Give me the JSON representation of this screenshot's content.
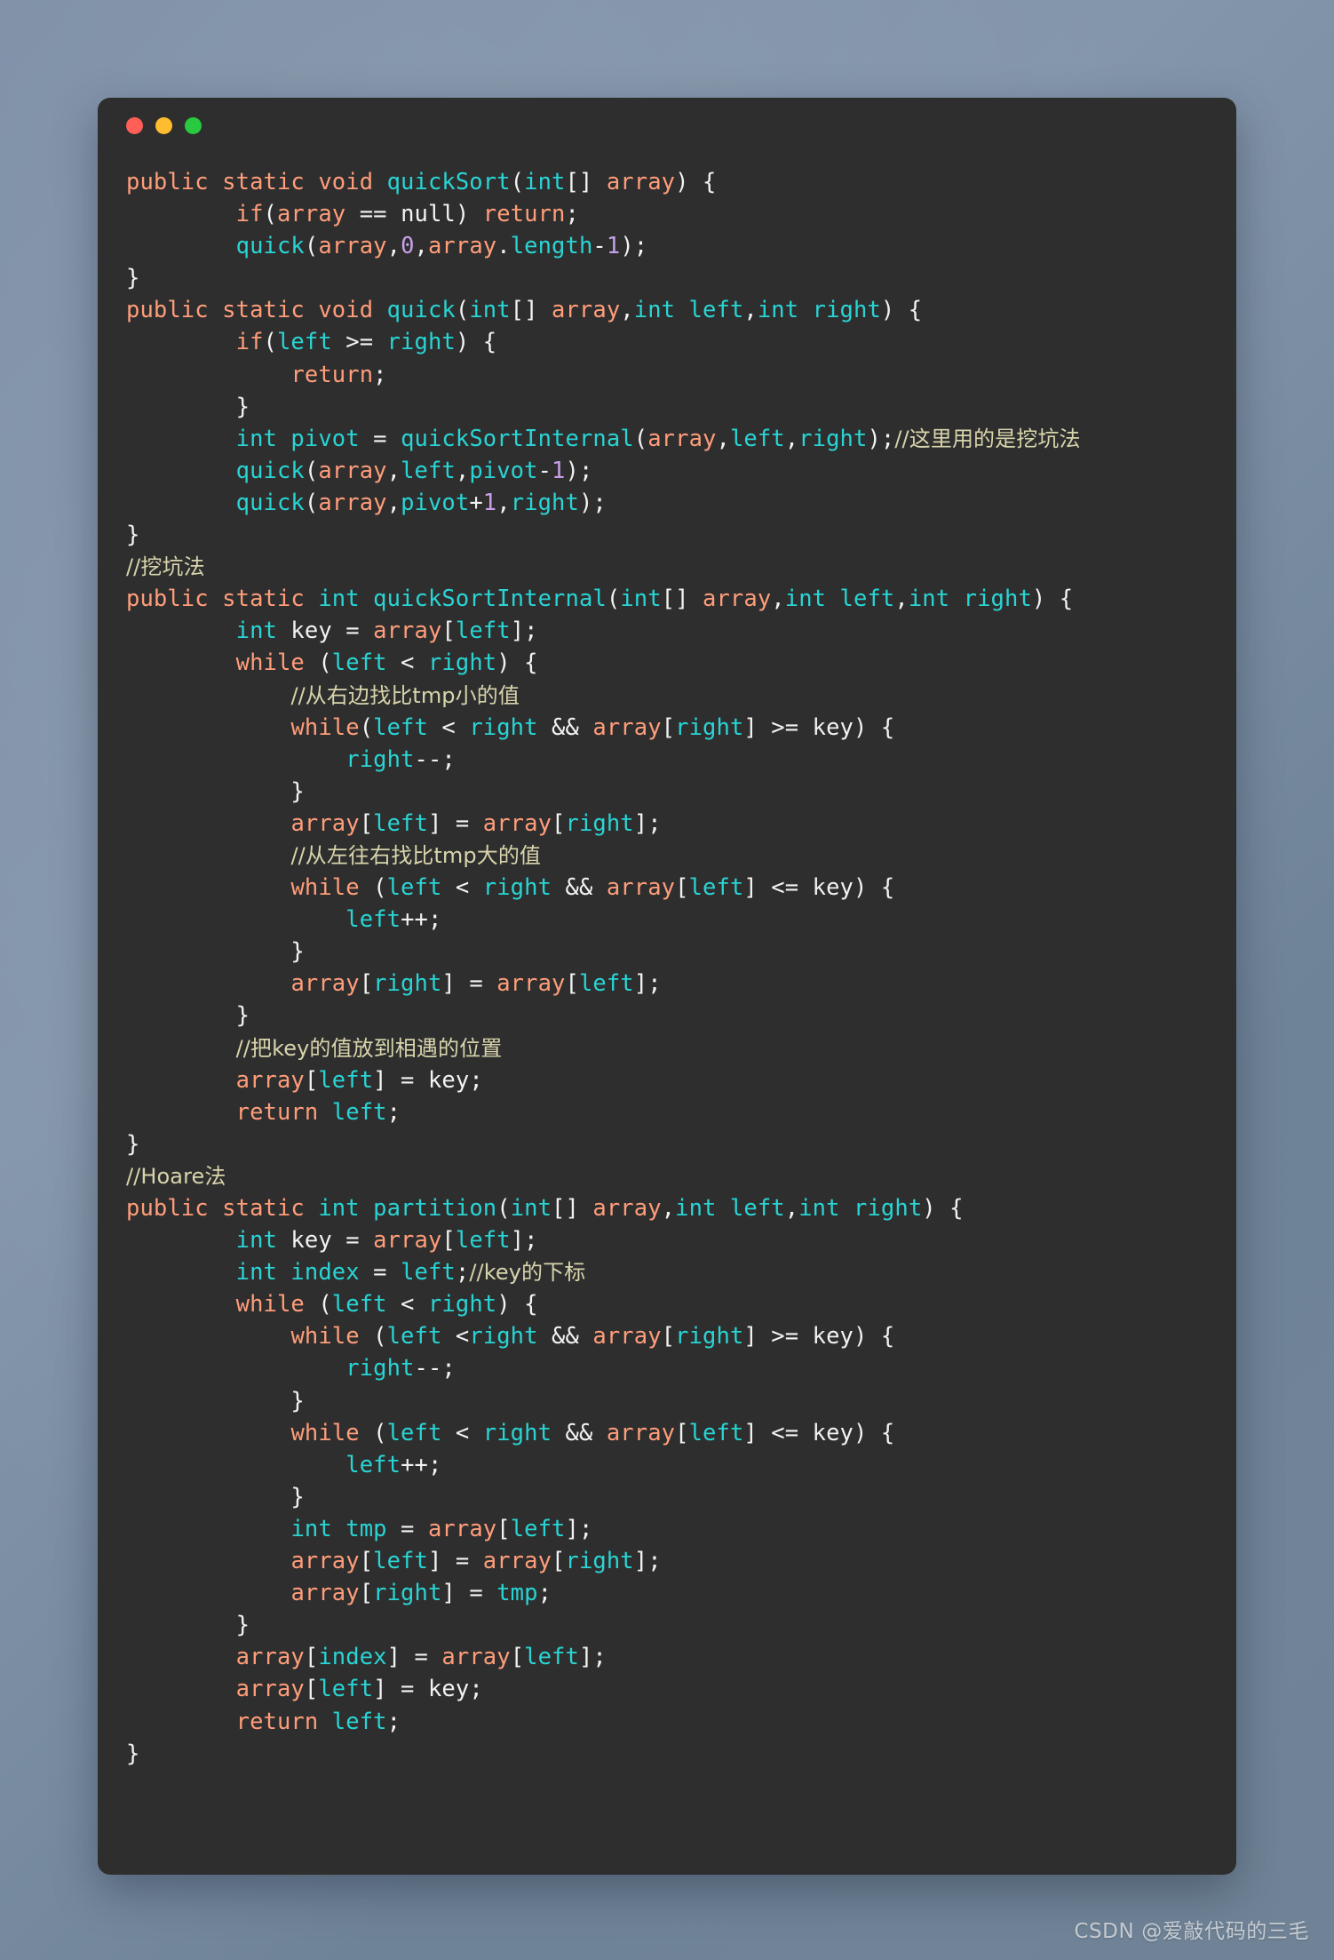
{
  "window": {
    "title": "code-snippet",
    "traffic_lights": [
      {
        "name": "close-button",
        "color": "#ff5f57"
      },
      {
        "name": "minimize-button",
        "color": "#febc2e"
      },
      {
        "name": "maximize-button",
        "color": "#28c840"
      }
    ]
  },
  "theme": {
    "background": "#7d8fa6",
    "window_background": "#2e2e2e",
    "keyword": "#ff9d7a",
    "type": "#2ad4d4",
    "number": "#c7a0e8",
    "comment": "#d8d4ac",
    "plain": "#f5f5f5"
  },
  "watermark": "CSDN @爱敲代码的三毛",
  "code": {
    "language": "Java",
    "lines": [
      [
        [
          "kw",
          "public static void "
        ],
        [
          "typ",
          "quickSort"
        ],
        [
          "pun",
          "("
        ],
        [
          "typ",
          "int"
        ],
        [
          "pun",
          "[] "
        ],
        [
          "var",
          "array"
        ],
        [
          "pun",
          ") {"
        ]
      ],
      [
        [
          "pun",
          "        "
        ],
        [
          "kw",
          "if"
        ],
        [
          "pun",
          "("
        ],
        [
          "var",
          "array"
        ],
        [
          "pun",
          " == "
        ],
        [
          "pun",
          "null"
        ],
        [
          "pun",
          ") "
        ],
        [
          "kw",
          "return"
        ],
        [
          "pun",
          ";"
        ]
      ],
      [
        [
          "pun",
          "        "
        ],
        [
          "typ",
          "quick"
        ],
        [
          "pun",
          "("
        ],
        [
          "var",
          "array"
        ],
        [
          "pun",
          ","
        ],
        [
          "num",
          "0"
        ],
        [
          "pun",
          ","
        ],
        [
          "var",
          "array"
        ],
        [
          "pun",
          "."
        ],
        [
          "typ",
          "length"
        ],
        [
          "pun",
          "-"
        ],
        [
          "num",
          "1"
        ],
        [
          "pun",
          ");"
        ]
      ],
      [
        [
          "pun",
          "}"
        ]
      ],
      [
        [
          "kw",
          "public static void "
        ],
        [
          "typ",
          "quick"
        ],
        [
          "pun",
          "("
        ],
        [
          "typ",
          "int"
        ],
        [
          "pun",
          "[] "
        ],
        [
          "var",
          "array"
        ],
        [
          "pun",
          ","
        ],
        [
          "typ",
          "int left"
        ],
        [
          "pun",
          ","
        ],
        [
          "typ",
          "int right"
        ],
        [
          "pun",
          ") {"
        ]
      ],
      [
        [
          "pun",
          "        "
        ],
        [
          "kw",
          "if"
        ],
        [
          "pun",
          "("
        ],
        [
          "typ",
          "left"
        ],
        [
          "pun",
          " >= "
        ],
        [
          "typ",
          "right"
        ],
        [
          "pun",
          ") {"
        ]
      ],
      [
        [
          "pun",
          "            "
        ],
        [
          "kw",
          "return"
        ],
        [
          "pun",
          ";"
        ]
      ],
      [
        [
          "pun",
          "        }"
        ]
      ],
      [
        [
          "pun",
          "        "
        ],
        [
          "typ",
          "int pivot"
        ],
        [
          "pun",
          " = "
        ],
        [
          "typ",
          "quickSortInternal"
        ],
        [
          "pun",
          "("
        ],
        [
          "var",
          "array"
        ],
        [
          "pun",
          ","
        ],
        [
          "typ",
          "left"
        ],
        [
          "pun",
          ","
        ],
        [
          "typ",
          "right"
        ],
        [
          "pun",
          ");"
        ],
        [
          "cmt",
          "//这里用的是挖坑法"
        ]
      ],
      [
        [
          "pun",
          "        "
        ],
        [
          "typ",
          "quick"
        ],
        [
          "pun",
          "("
        ],
        [
          "var",
          "array"
        ],
        [
          "pun",
          ","
        ],
        [
          "typ",
          "left"
        ],
        [
          "pun",
          ","
        ],
        [
          "typ",
          "pivot"
        ],
        [
          "pun",
          "-"
        ],
        [
          "num",
          "1"
        ],
        [
          "pun",
          ");"
        ]
      ],
      [
        [
          "pun",
          "        "
        ],
        [
          "typ",
          "quick"
        ],
        [
          "pun",
          "("
        ],
        [
          "var",
          "array"
        ],
        [
          "pun",
          ","
        ],
        [
          "typ",
          "pivot"
        ],
        [
          "pun",
          "+"
        ],
        [
          "num",
          "1"
        ],
        [
          "pun",
          ","
        ],
        [
          "typ",
          "right"
        ],
        [
          "pun",
          ");"
        ]
      ],
      [
        [
          "pun",
          "}"
        ]
      ],
      [
        [
          "cmt",
          "//挖坑法"
        ]
      ],
      [
        [
          "kw",
          "public static "
        ],
        [
          "typ",
          "int"
        ],
        [
          "kw",
          " "
        ],
        [
          "typ",
          "quickSortInternal"
        ],
        [
          "pun",
          "("
        ],
        [
          "typ",
          "int"
        ],
        [
          "pun",
          "[] "
        ],
        [
          "var",
          "array"
        ],
        [
          "pun",
          ","
        ],
        [
          "typ",
          "int left"
        ],
        [
          "pun",
          ","
        ],
        [
          "typ",
          "int right"
        ],
        [
          "pun",
          ") {"
        ]
      ],
      [
        [
          "pun",
          "        "
        ],
        [
          "typ",
          "int"
        ],
        [
          "pun",
          " key = "
        ],
        [
          "var",
          "array"
        ],
        [
          "pun",
          "["
        ],
        [
          "typ",
          "left"
        ],
        [
          "pun",
          "];"
        ]
      ],
      [
        [
          "pun",
          "        "
        ],
        [
          "kw",
          "while"
        ],
        [
          "pun",
          " ("
        ],
        [
          "typ",
          "left"
        ],
        [
          "pun",
          " < "
        ],
        [
          "typ",
          "right"
        ],
        [
          "pun",
          ") {"
        ]
      ],
      [
        [
          "pun",
          "            "
        ],
        [
          "cmt",
          "//从右边找比tmp小的值"
        ]
      ],
      [
        [
          "pun",
          "            "
        ],
        [
          "kw",
          "while"
        ],
        [
          "pun",
          "("
        ],
        [
          "typ",
          "left"
        ],
        [
          "pun",
          " < "
        ],
        [
          "typ",
          "right"
        ],
        [
          "pun",
          " && "
        ],
        [
          "var",
          "array"
        ],
        [
          "pun",
          "["
        ],
        [
          "typ",
          "right"
        ],
        [
          "pun",
          "] >= key) {"
        ]
      ],
      [
        [
          "pun",
          "                "
        ],
        [
          "typ",
          "right"
        ],
        [
          "pun",
          "--;"
        ]
      ],
      [
        [
          "pun",
          "            }"
        ]
      ],
      [
        [
          "pun",
          "            "
        ],
        [
          "var",
          "array"
        ],
        [
          "pun",
          "["
        ],
        [
          "typ",
          "left"
        ],
        [
          "pun",
          "] = "
        ],
        [
          "var",
          "array"
        ],
        [
          "pun",
          "["
        ],
        [
          "typ",
          "right"
        ],
        [
          "pun",
          "];"
        ]
      ],
      [
        [
          "pun",
          "            "
        ],
        [
          "cmt",
          "//从左往右找比tmp大的值"
        ]
      ],
      [
        [
          "pun",
          "            "
        ],
        [
          "kw",
          "while"
        ],
        [
          "pun",
          " ("
        ],
        [
          "typ",
          "left"
        ],
        [
          "pun",
          " < "
        ],
        [
          "typ",
          "right"
        ],
        [
          "pun",
          " && "
        ],
        [
          "var",
          "array"
        ],
        [
          "pun",
          "["
        ],
        [
          "typ",
          "left"
        ],
        [
          "pun",
          "] <= key) {"
        ]
      ],
      [
        [
          "pun",
          "                "
        ],
        [
          "typ",
          "left"
        ],
        [
          "pun",
          "++;"
        ]
      ],
      [
        [
          "pun",
          "            }"
        ]
      ],
      [
        [
          "pun",
          "            "
        ],
        [
          "var",
          "array"
        ],
        [
          "pun",
          "["
        ],
        [
          "typ",
          "right"
        ],
        [
          "pun",
          "] = "
        ],
        [
          "var",
          "array"
        ],
        [
          "pun",
          "["
        ],
        [
          "typ",
          "left"
        ],
        [
          "pun",
          "];"
        ]
      ],
      [
        [
          "pun",
          "        }"
        ]
      ],
      [
        [
          "pun",
          "        "
        ],
        [
          "cmt",
          "//把key的值放到相遇的位置"
        ]
      ],
      [
        [
          "pun",
          "        "
        ],
        [
          "var",
          "array"
        ],
        [
          "pun",
          "["
        ],
        [
          "typ",
          "left"
        ],
        [
          "pun",
          "] = key;"
        ]
      ],
      [
        [
          "pun",
          "        "
        ],
        [
          "kw",
          "return"
        ],
        [
          "pun",
          " "
        ],
        [
          "typ",
          "left"
        ],
        [
          "pun",
          ";"
        ]
      ],
      [
        [
          "pun",
          "}"
        ]
      ],
      [
        [
          "cmt",
          "//Hoare法"
        ]
      ],
      [
        [
          "kw",
          "public static "
        ],
        [
          "typ",
          "int"
        ],
        [
          "kw",
          " "
        ],
        [
          "typ",
          "partition"
        ],
        [
          "pun",
          "("
        ],
        [
          "typ",
          "int"
        ],
        [
          "pun",
          "[] "
        ],
        [
          "var",
          "array"
        ],
        [
          "pun",
          ","
        ],
        [
          "typ",
          "int left"
        ],
        [
          "pun",
          ","
        ],
        [
          "typ",
          "int right"
        ],
        [
          "pun",
          ") {"
        ]
      ],
      [
        [
          "pun",
          "        "
        ],
        [
          "typ",
          "int"
        ],
        [
          "pun",
          " key = "
        ],
        [
          "var",
          "array"
        ],
        [
          "pun",
          "["
        ],
        [
          "typ",
          "left"
        ],
        [
          "pun",
          "];"
        ]
      ],
      [
        [
          "pun",
          "        "
        ],
        [
          "typ",
          "int index"
        ],
        [
          "pun",
          " = "
        ],
        [
          "typ",
          "left"
        ],
        [
          "pun",
          ";"
        ],
        [
          "cmt",
          "//key的下标"
        ]
      ],
      [
        [
          "pun",
          "        "
        ],
        [
          "kw",
          "while"
        ],
        [
          "pun",
          " ("
        ],
        [
          "typ",
          "left"
        ],
        [
          "pun",
          " < "
        ],
        [
          "typ",
          "right"
        ],
        [
          "pun",
          ") {"
        ]
      ],
      [
        [
          "pun",
          "            "
        ],
        [
          "kw",
          "while"
        ],
        [
          "pun",
          " ("
        ],
        [
          "typ",
          "left"
        ],
        [
          "pun",
          " <"
        ],
        [
          "typ",
          "right"
        ],
        [
          "pun",
          " && "
        ],
        [
          "var",
          "array"
        ],
        [
          "pun",
          "["
        ],
        [
          "typ",
          "right"
        ],
        [
          "pun",
          "] >= key) {"
        ]
      ],
      [
        [
          "pun",
          "                "
        ],
        [
          "typ",
          "right"
        ],
        [
          "pun",
          "--;"
        ]
      ],
      [
        [
          "pun",
          "            }"
        ]
      ],
      [
        [
          "pun",
          "            "
        ],
        [
          "kw",
          "while"
        ],
        [
          "pun",
          " ("
        ],
        [
          "typ",
          "left"
        ],
        [
          "pun",
          " < "
        ],
        [
          "typ",
          "right"
        ],
        [
          "pun",
          " && "
        ],
        [
          "var",
          "array"
        ],
        [
          "pun",
          "["
        ],
        [
          "typ",
          "left"
        ],
        [
          "pun",
          "] <= key) {"
        ]
      ],
      [
        [
          "pun",
          "                "
        ],
        [
          "typ",
          "left"
        ],
        [
          "pun",
          "++;"
        ]
      ],
      [
        [
          "pun",
          "            }"
        ]
      ],
      [
        [
          "pun",
          "            "
        ],
        [
          "typ",
          "int tmp"
        ],
        [
          "pun",
          " = "
        ],
        [
          "var",
          "array"
        ],
        [
          "pun",
          "["
        ],
        [
          "typ",
          "left"
        ],
        [
          "pun",
          "];"
        ]
      ],
      [
        [
          "pun",
          "            "
        ],
        [
          "var",
          "array"
        ],
        [
          "pun",
          "["
        ],
        [
          "typ",
          "left"
        ],
        [
          "pun",
          "] = "
        ],
        [
          "var",
          "array"
        ],
        [
          "pun",
          "["
        ],
        [
          "typ",
          "right"
        ],
        [
          "pun",
          "];"
        ]
      ],
      [
        [
          "pun",
          "            "
        ],
        [
          "var",
          "array"
        ],
        [
          "pun",
          "["
        ],
        [
          "typ",
          "right"
        ],
        [
          "pun",
          "] = "
        ],
        [
          "typ",
          "tmp"
        ],
        [
          "pun",
          ";"
        ]
      ],
      [
        [
          "pun",
          "        }"
        ]
      ],
      [
        [
          "pun",
          "        "
        ],
        [
          "var",
          "array"
        ],
        [
          "pun",
          "["
        ],
        [
          "typ",
          "index"
        ],
        [
          "pun",
          "] = "
        ],
        [
          "var",
          "array"
        ],
        [
          "pun",
          "["
        ],
        [
          "typ",
          "left"
        ],
        [
          "pun",
          "];"
        ]
      ],
      [
        [
          "pun",
          "        "
        ],
        [
          "var",
          "array"
        ],
        [
          "pun",
          "["
        ],
        [
          "typ",
          "left"
        ],
        [
          "pun",
          "] = key;"
        ]
      ],
      [
        [
          "pun",
          "        "
        ],
        [
          "kw",
          "return"
        ],
        [
          "pun",
          " "
        ],
        [
          "typ",
          "left"
        ],
        [
          "pun",
          ";"
        ]
      ],
      [
        [
          "pun",
          "}"
        ]
      ]
    ]
  }
}
